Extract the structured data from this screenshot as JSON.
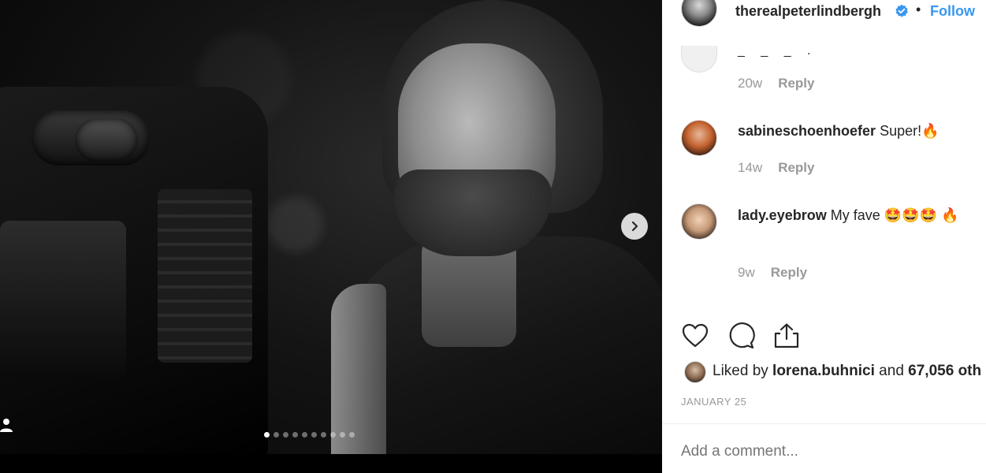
{
  "photo": {
    "carousel": {
      "total": 10,
      "active_index": 0
    },
    "icons": {
      "next": "chevron-right-icon",
      "tag": "user-tag-icon"
    }
  },
  "header": {
    "username": "therealpeterlindbergh",
    "separator": "•",
    "follow_label": "Follow",
    "verified_icon": "verified-badge-icon",
    "accent_color": "#3897f0"
  },
  "comments": [
    {
      "username": "",
      "text": "_ _ _ .",
      "time": "20w",
      "reply_label": "Reply"
    },
    {
      "username": "sabineschoenhoefer",
      "text": "Super!🔥",
      "time": "14w",
      "reply_label": "Reply"
    },
    {
      "username": "lady.eyebrow",
      "text": "My fave 🤩🤩🤩 🔥",
      "time": "9w",
      "reply_label": "Reply"
    }
  ],
  "actions": {
    "icons": [
      "heart-icon",
      "comment-icon",
      "share-icon"
    ]
  },
  "likes": {
    "prefix": "Liked by ",
    "user": "lorena.buhnici",
    "middle": " and ",
    "count": "67,056 oth"
  },
  "date": "JANUARY 25",
  "add_comment": {
    "placeholder": "Add a comment..."
  }
}
